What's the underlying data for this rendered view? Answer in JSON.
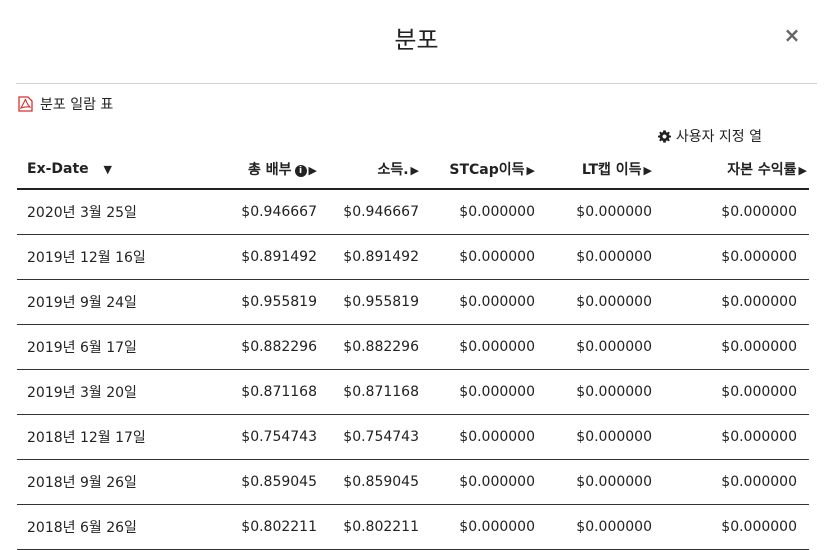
{
  "modal": {
    "title": "분포",
    "close_label": "×"
  },
  "pdf_link": {
    "label": "분포 일람 표"
  },
  "custom_columns": {
    "label": "사용자 지정 열"
  },
  "table": {
    "headers": [
      {
        "label": "Ex-Date",
        "arrow": "▼"
      },
      {
        "label": "총 배부",
        "arrow": "▶",
        "info": "i"
      },
      {
        "label": "소득.",
        "arrow": "▶"
      },
      {
        "label": "STCap이득",
        "arrow": "▶"
      },
      {
        "label": "LT캡 이득",
        "arrow": "▶"
      },
      {
        "label": "자본 수익률",
        "arrow": "▶"
      }
    ],
    "rows": [
      {
        "date": "2020년 3월 25일",
        "total": "$0.946667",
        "income": "$0.946667",
        "stcap": "$0.000000",
        "ltcap": "$0.000000",
        "roc": "$0.000000"
      },
      {
        "date": "2019년 12월 16일",
        "total": "$0.891492",
        "income": "$0.891492",
        "stcap": "$0.000000",
        "ltcap": "$0.000000",
        "roc": "$0.000000"
      },
      {
        "date": "2019년 9월 24일",
        "total": "$0.955819",
        "income": "$0.955819",
        "stcap": "$0.000000",
        "ltcap": "$0.000000",
        "roc": "$0.000000"
      },
      {
        "date": "2019년 6월 17일",
        "total": "$0.882296",
        "income": "$0.882296",
        "stcap": "$0.000000",
        "ltcap": "$0.000000",
        "roc": "$0.000000"
      },
      {
        "date": "2019년 3월 20일",
        "total": "$0.871168",
        "income": "$0.871168",
        "stcap": "$0.000000",
        "ltcap": "$0.000000",
        "roc": "$0.000000"
      },
      {
        "date": "2018년 12월 17일",
        "total": "$0.754743",
        "income": "$0.754743",
        "stcap": "$0.000000",
        "ltcap": "$0.000000",
        "roc": "$0.000000"
      },
      {
        "date": "2018년 9월 26일",
        "total": "$0.859045",
        "income": "$0.859045",
        "stcap": "$0.000000",
        "ltcap": "$0.000000",
        "roc": "$0.000000"
      },
      {
        "date": "2018년 6월 26일",
        "total": "$0.802211",
        "income": "$0.802211",
        "stcap": "$0.000000",
        "ltcap": "$0.000000",
        "roc": "$0.000000"
      }
    ]
  },
  "colors": {
    "pdf_icon": "#d2322d",
    "rule": "#222222"
  }
}
